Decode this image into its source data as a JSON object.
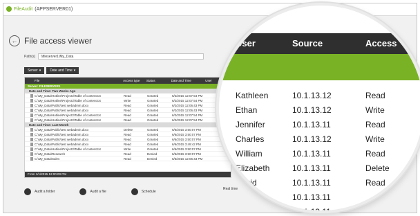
{
  "app": {
    "name": "FileAudit",
    "server": "(APPSERVER01)"
  },
  "page": {
    "title": "File access viewer"
  },
  "path": {
    "label": "Path(s)",
    "value": "\\\\fileserver1\\My_Data"
  },
  "filters": [
    {
      "label": "Server"
    },
    {
      "label": "Date and Time"
    }
  ],
  "grid": {
    "columns": [
      "File",
      "Access type",
      "Status",
      "Date and Time",
      "User"
    ],
    "group_server": "Server: FILESERVER1",
    "groups": [
      {
        "label": "Date and Time: Two Weeks Ago",
        "rows": [
          {
            "file": "C:\\My_Data\\Hotline\\Project3\\Table of content.txt",
            "access": "Read",
            "status": "Granted",
            "date": "6/2/2015 12:07:54 PM"
          },
          {
            "file": "C:\\My_Data\\Hotline\\Project3\\Table of content.txt",
            "access": "Write",
            "status": "Granted",
            "date": "6/2/2015 12:07:54 PM"
          },
          {
            "file": "C:\\My_Data\\Public\\test webadmin.docx",
            "access": "Read",
            "status": "Granted",
            "date": "6/2/2015 12:06:43 PM"
          },
          {
            "file": "C:\\My_Data\\Public\\test webadmin.docx",
            "access": "Read",
            "status": "Granted",
            "date": "6/2/2015 12:06:43 PM"
          },
          {
            "file": "C:\\My_Data\\Hotline\\Project3\\Table of content.txt",
            "access": "Read",
            "status": "Granted",
            "date": "6/2/2015 12:07:54 PM"
          },
          {
            "file": "C:\\My_Data\\Hotline\\Project3\\Table of content.txt",
            "access": "Read",
            "status": "Granted",
            "date": "6/2/2015 12:07:54 PM"
          }
        ]
      },
      {
        "label": "Date and Time: Last Month",
        "rows": [
          {
            "file": "C:\\My_Data\\Public\\test webadmin.docx",
            "access": "Delete",
            "status": "Granted",
            "date": "6/6/2015 3:50:07 PM"
          },
          {
            "file": "C:\\My_Data\\Public\\test webadmin.docx",
            "access": "Read",
            "status": "Granted",
            "date": "6/6/2015 3:50:07 PM"
          },
          {
            "file": "C:\\My_Data\\Public\\test webadmin.docx",
            "access": "Read",
            "status": "Granted",
            "date": "6/6/2015 3:50:07 PM"
          },
          {
            "file": "C:\\My_Data\\Public\\test webadmin.docx",
            "access": "Read",
            "status": "Granted",
            "date": "6/6/2015 3:49:42 PM"
          },
          {
            "file": "C:\\My_Data\\Hotline\\Project3\\Table of content.txt",
            "access": "Write",
            "status": "Granted",
            "date": "6/6/2015 3:50:07 PM"
          },
          {
            "file": "C:\\My_Data\\Research",
            "access": "Read",
            "status": "Denied",
            "date": "6/6/2015 3:50:07 PM"
          },
          {
            "file": "C:\\My_Data\\Sales",
            "access": "Read",
            "status": "Denied",
            "date": "6/6/2015 12:06:43 PM"
          }
        ]
      }
    ],
    "footer": "From 1/1/2015 12:00:00 PM"
  },
  "dock": [
    {
      "label": "Audit a folder",
      "icon": "folder-icon"
    },
    {
      "label": "Audit a file",
      "icon": "file-icon"
    },
    {
      "label": "Schedule",
      "icon": "clock-icon"
    }
  ],
  "realtime": "Real time",
  "lens": {
    "columns": [
      "User",
      "Source",
      "Access"
    ],
    "rows": [
      {
        "user": "Kathleen",
        "source": "10.1.13.12",
        "access": "Read"
      },
      {
        "user": "Ethan",
        "source": "10.1.13.12",
        "access": "Write"
      },
      {
        "user": "Jennifer",
        "source": "10.1.13.11",
        "access": "Read"
      },
      {
        "user": "Charles",
        "source": "10.1.13.12",
        "access": "Write"
      },
      {
        "user": "William",
        "source": "10.1.13.11",
        "access": "Read"
      },
      {
        "user": "Elizabeth",
        "source": "10.1.13.11",
        "access": "Delete"
      },
      {
        "user": "David",
        "source": "10.1.13.11",
        "access": "Read"
      },
      {
        "user": "",
        "source": "10.1.13.11",
        "access": ""
      },
      {
        "user": "",
        "source": "10.1.13.11",
        "access": ""
      }
    ]
  }
}
